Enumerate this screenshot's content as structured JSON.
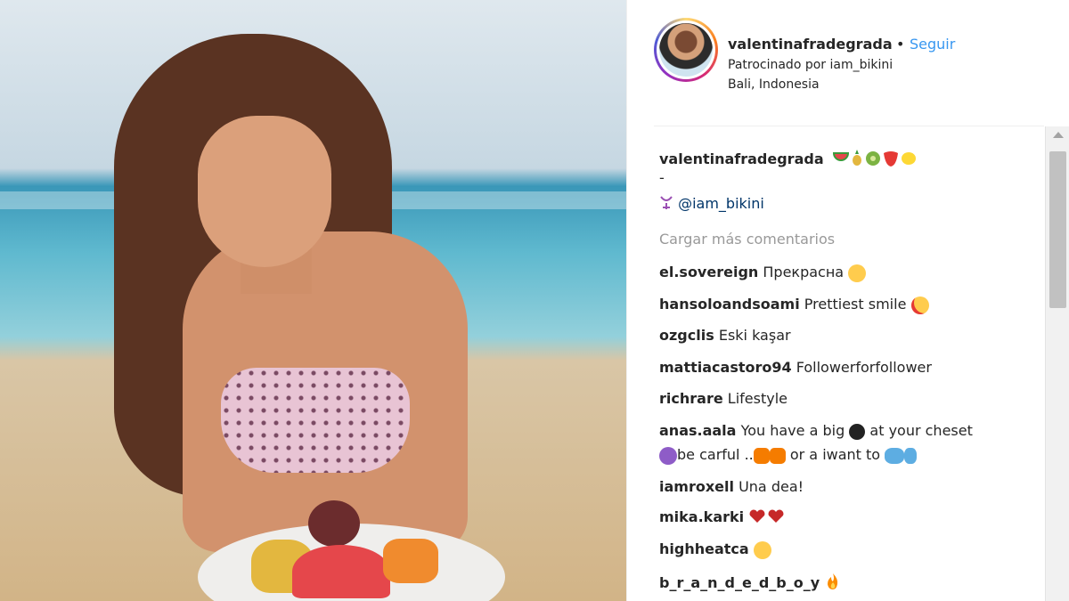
{
  "post": {
    "username": "valentinafradegrada",
    "separator": "•",
    "follow_label": "Seguir",
    "sponsor_text": "Patrocinado por iam_bikini",
    "location": "Bali, Indonesia"
  },
  "caption": {
    "username": "valentinafradegrada",
    "emoji_icons": [
      "watermelon",
      "pineapple",
      "kiwi",
      "strawberry",
      "lemon"
    ],
    "dash": "-",
    "mention": "@iam_bikini",
    "mention_icon": "bikini-glyph"
  },
  "load_more_label": "Cargar más comentarios",
  "comments": [
    {
      "user": "el.sovereign",
      "text": "Прекрасна",
      "emoji": "smirk-face"
    },
    {
      "user": "hansoloandsoami",
      "text": "Prettiest smile",
      "emoji": "heart-eyes-face"
    },
    {
      "user": "ozgclis",
      "text": "Eski kaşar",
      "emoji": ""
    },
    {
      "user": "mattiacastoro94",
      "text": "Followerforfollower",
      "emoji": ""
    },
    {
      "user": "richrare",
      "text": "Lifestyle",
      "emoji": ""
    },
    {
      "user": "anas.aala",
      "text": "You have a big",
      "text2": "at your cheset",
      "text3": "be carful ..",
      "text4": "or a iwant to",
      "emoji": "bomb"
    },
    {
      "user": "iamroxell",
      "text": "Una dea!",
      "emoji": ""
    },
    {
      "user": "mika.karki",
      "text": "",
      "emoji": "two-hearts"
    },
    {
      "user": "highheatca",
      "text": "",
      "emoji": "yum-face"
    },
    {
      "user": "b_r_a_n_d_e_d_b_o_y",
      "text": "",
      "emoji": "fire"
    }
  ],
  "colors": {
    "link": "#3897f0",
    "text": "#262626",
    "muted": "#999999"
  }
}
